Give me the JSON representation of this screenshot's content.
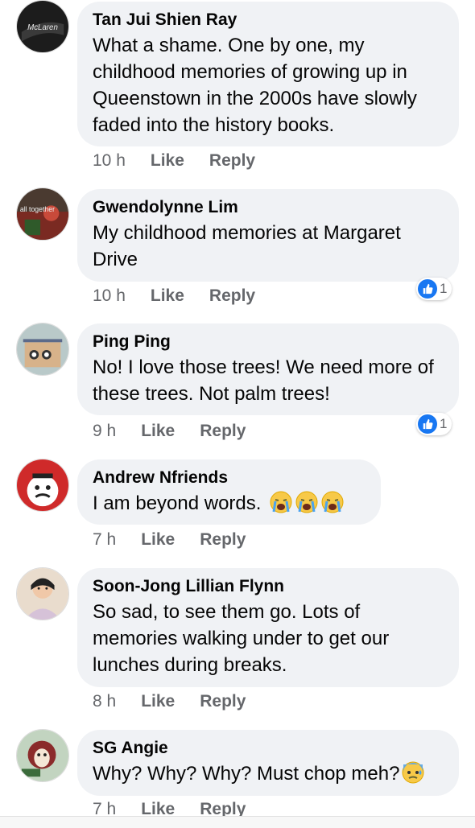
{
  "comments": [
    {
      "author": "Tan Jui Shien Ray",
      "text": "What a shame. One by one, my childhood memories of growing up in Queenstown in the 2000s have slowly faded into the history books.",
      "time": "10 h",
      "like": "Like",
      "reply": "Reply",
      "avatar_label": "McLaren"
    },
    {
      "author": "Gwendolynne Lim",
      "text": "My childhood memories at Margaret Drive",
      "time": "10 h",
      "like": "Like",
      "reply": "Reply",
      "reactions": "1",
      "avatar_label": "all together"
    },
    {
      "author": "Ping Ping",
      "text": "No! I love those trees! We need more of these trees. Not palm trees!",
      "time": "9 h",
      "like": "Like",
      "reply": "Reply",
      "reactions": "1"
    },
    {
      "author": "Andrew Nfriends",
      "text": "I am beyond words.",
      "time": "7 h",
      "like": "Like",
      "reply": "Reply",
      "emoji": "loudly-crying-face x3"
    },
    {
      "author": "Soon-Jong Lillian Flynn",
      "text": "So sad, to see them go. Lots of memories walking under to get our lunches during breaks.",
      "time": "8 h",
      "like": "Like",
      "reply": "Reply"
    },
    {
      "author": "SG Angie",
      "text": "Why? Why? Why? Must chop meh?",
      "time": "7 h",
      "like": "Like",
      "reply": "Reply",
      "emoji": "anxious-face-with-sweat"
    }
  ],
  "colors": {
    "bubble": "#f0f2f5",
    "meta": "#65676b",
    "like_blue": "#1877f2"
  }
}
